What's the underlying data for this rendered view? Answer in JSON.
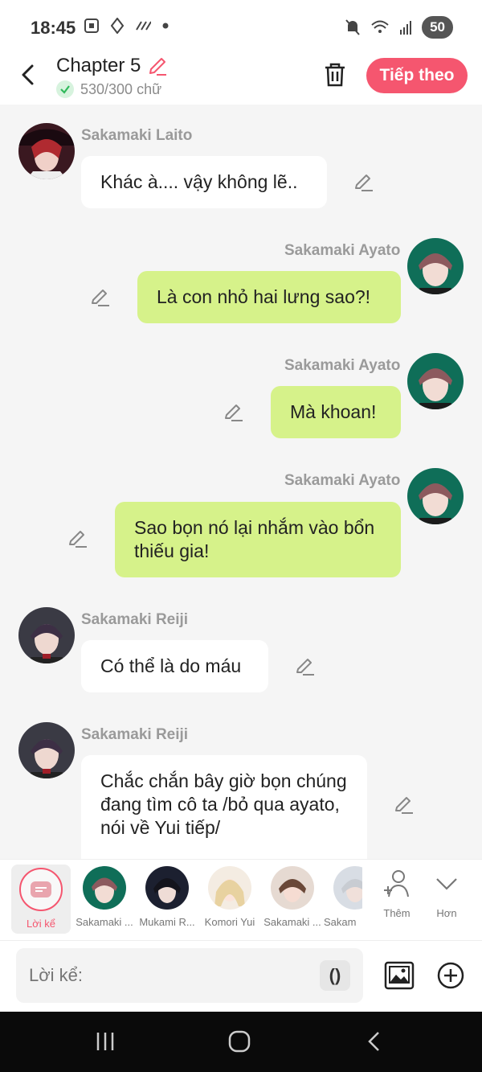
{
  "status_bar": {
    "time": "18:45",
    "battery": "50"
  },
  "header": {
    "title": "Chapter 5",
    "word_count": "530/300 chữ",
    "next_label": "Tiếp theo"
  },
  "messages": [
    {
      "side": "left",
      "sender": "Sakamaki Laito",
      "text": "Khác à.... vậy không lẽ.."
    },
    {
      "side": "right",
      "sender": "Sakamaki Ayato",
      "text": "Là con nhỏ hai lưng sao?!"
    },
    {
      "side": "right",
      "sender": "Sakamaki Ayato",
      "text": "Mà khoan!"
    },
    {
      "side": "right",
      "sender": "Sakamaki Ayato",
      "text": "Sao bọn nó lại nhắm vào bổn thiếu gia!"
    },
    {
      "side": "left",
      "sender": "Sakamaki Reiji",
      "text": "Có thể là do máu"
    },
    {
      "side": "left",
      "sender": "Sakamaki Reiji",
      "text": "Chắc chắn bây giờ bọn chúng đang tìm cô ta /bỏ qua ayato, nói về Yui tiếp/"
    }
  ],
  "character_bar": {
    "narrator_label": "Lời kể",
    "characters": [
      "Sakamaki ...",
      "Mukami R...",
      "Komori Yui",
      "Sakamaki ...",
      "Sakam"
    ],
    "add_label": "Thêm",
    "more_label": "Hơn"
  },
  "input": {
    "placeholder": "Lời kể:",
    "paren_label": "()"
  },
  "colors": {
    "accent": "#f5566f",
    "right_bubble": "#d6f28a",
    "left_bubble": "#ffffff"
  }
}
